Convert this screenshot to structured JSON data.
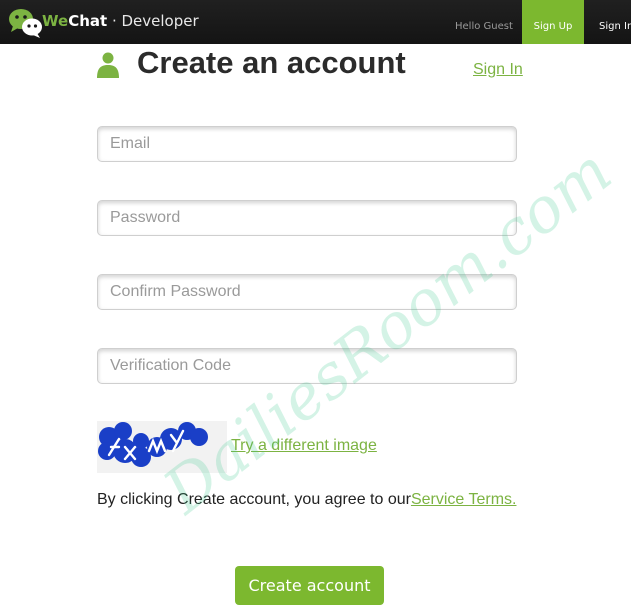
{
  "header": {
    "brand_we": "We",
    "brand_chat": "Chat",
    "brand_suffix": " · Developer",
    "logo_icon": "wechat-bubbles-icon",
    "greeting": "Hello Guest",
    "nav": [
      {
        "label": "Sign Up",
        "active": true
      },
      {
        "label": "Sign In",
        "active": false
      }
    ]
  },
  "page": {
    "icon": "person-icon",
    "title": "Create an account",
    "signin_link": "Sign In"
  },
  "form": {
    "fields": [
      {
        "name": "email",
        "placeholder": "Email",
        "value": ""
      },
      {
        "name": "password",
        "placeholder": "Password",
        "value": ""
      },
      {
        "name": "confirm-password",
        "placeholder": "Confirm Password",
        "value": ""
      },
      {
        "name": "verification-code",
        "placeholder": "Verification Code",
        "value": ""
      }
    ],
    "captcha_text": "fxmy",
    "try_different": "Try a different image",
    "terms_prefix": "By clicking Create account, you agree to our",
    "terms_link": "Service Terms.",
    "submit": "Create account"
  },
  "watermark": "DailiesRoom.com",
  "colors": {
    "accent": "#7cb82f",
    "link": "#7cb342",
    "topbar": "#181818",
    "captcha_blue": "#1a3fc7"
  }
}
